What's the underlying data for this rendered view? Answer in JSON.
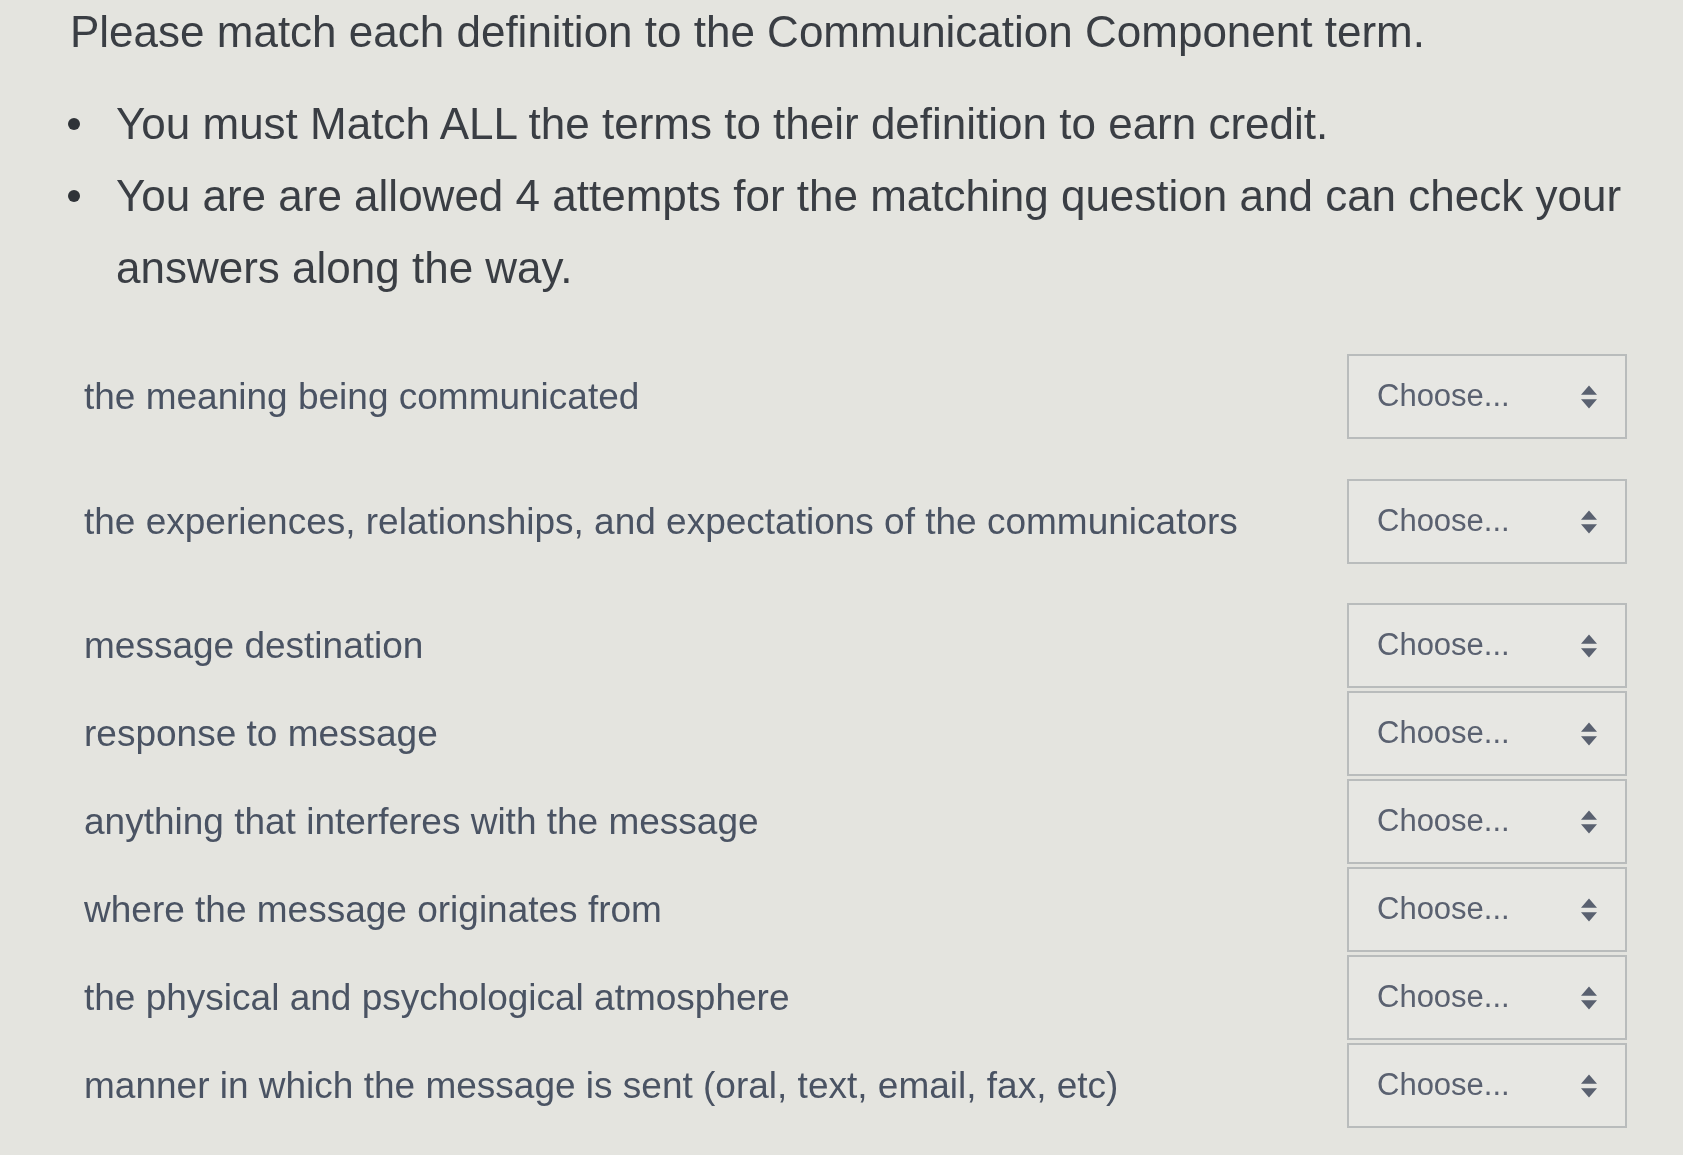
{
  "question": {
    "title": "Please match each definition to the Communication Component term.",
    "instructions": [
      "You must Match ALL the terms to their definition to earn credit.",
      "You are are allowed 4 attempts for the matching question and can check your answers along the way."
    ]
  },
  "matches": [
    {
      "definition": "the meaning being communicated",
      "select_value": "Choose..."
    },
    {
      "definition": "the experiences, relationships, and expectations of the communicators",
      "select_value": "Choose..."
    },
    {
      "definition": "message destination",
      "select_value": "Choose..."
    },
    {
      "definition": "response to message",
      "select_value": "Choose..."
    },
    {
      "definition": "anything that interferes with the message",
      "select_value": "Choose..."
    },
    {
      "definition": "where the message originates from",
      "select_value": "Choose..."
    },
    {
      "definition": "the physical and psychological atmosphere",
      "select_value": "Choose..."
    },
    {
      "definition": "manner in which the message is sent (oral, text, email, fax, etc)",
      "select_value": "Choose..."
    }
  ]
}
